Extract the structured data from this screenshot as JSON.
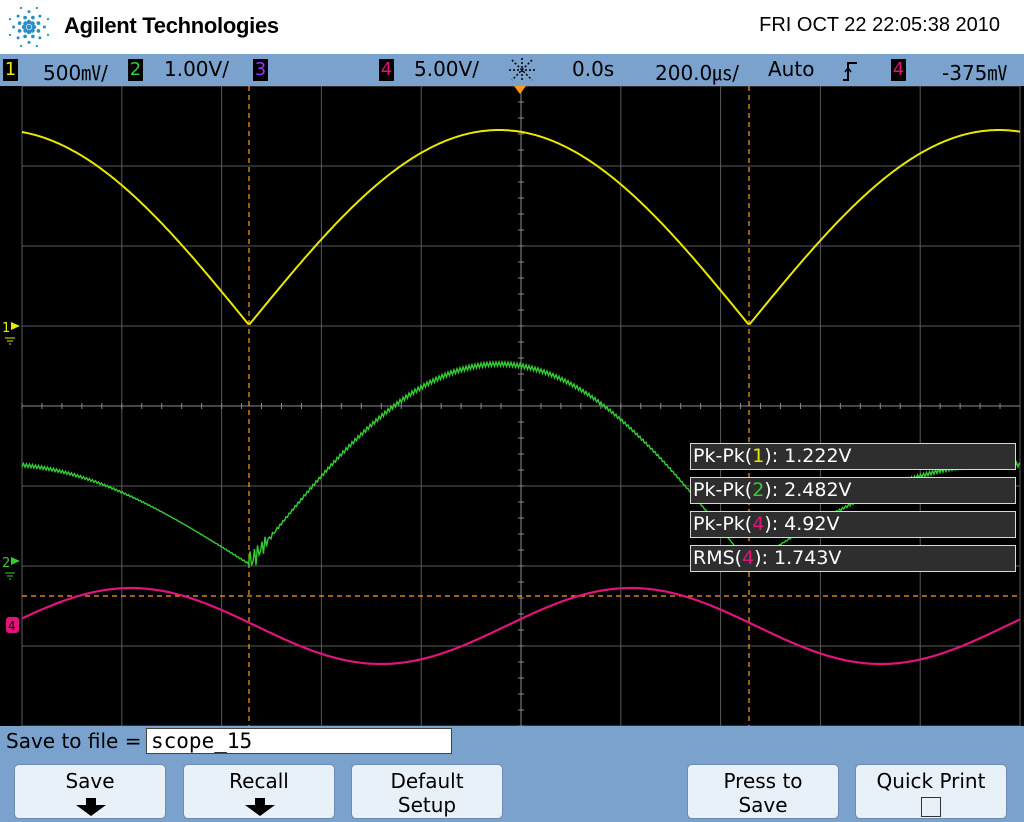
{
  "header": {
    "brand": "Agilent Technologies",
    "datetime": "FRI OCT 22 22:05:38 2010"
  },
  "statusbar": {
    "ch1": {
      "num": "1",
      "scale": "500㎷/",
      "color": "#e8e800"
    },
    "ch2": {
      "num": "2",
      "scale": "1.00V/",
      "color": "#33cc33"
    },
    "ch3": {
      "num": "3",
      "color": "#9933ff"
    },
    "ch4": {
      "num": "4",
      "scale": "5.00V/",
      "color": "#e0147a"
    },
    "delay": "0.0s",
    "timebase": "200.0㎲/",
    "trigger_mode": "Auto",
    "trigger_slope_icon": "rising-edge-icon",
    "trigger_source": "4",
    "trigger_level": "-375㎷"
  },
  "markers": {
    "ch1": "1",
    "ch2": "2",
    "ch4": "4"
  },
  "measurements": [
    {
      "prefix": "Pk-Pk(",
      "channel": "1",
      "suffix": "): 1.222V",
      "color": "#e8e800"
    },
    {
      "prefix": "Pk-Pk(",
      "channel": "2",
      "suffix": "): 2.482V",
      "color": "#33cc33"
    },
    {
      "prefix": "Pk-Pk(",
      "channel": "4",
      "suffix": "): 4.92V",
      "color": "#e0147a"
    },
    {
      "prefix": "RMS(",
      "channel": "4",
      "suffix": "): 1.743V",
      "color": "#e0147a"
    }
  ],
  "save": {
    "label": "Save to file =",
    "filename": "scope_15"
  },
  "softkeys": [
    {
      "line1": "Save",
      "line2": "",
      "icon": "down-arrow-icon"
    },
    {
      "line1": "Recall",
      "line2": "",
      "icon": "down-arrow-icon"
    },
    {
      "line1": "Default",
      "line2": "Setup",
      "icon": ""
    },
    {
      "line1": "Press to",
      "line2": "Save",
      "icon": ""
    },
    {
      "line1": "Quick Print",
      "line2": "",
      "icon": "checkbox-icon"
    }
  ],
  "colors": {
    "grid": "#5a5a5a",
    "cursor": "#ff9a1a",
    "ch1": "#e8e800",
    "ch2": "#33cc33",
    "ch4": "#e0147a"
  }
}
